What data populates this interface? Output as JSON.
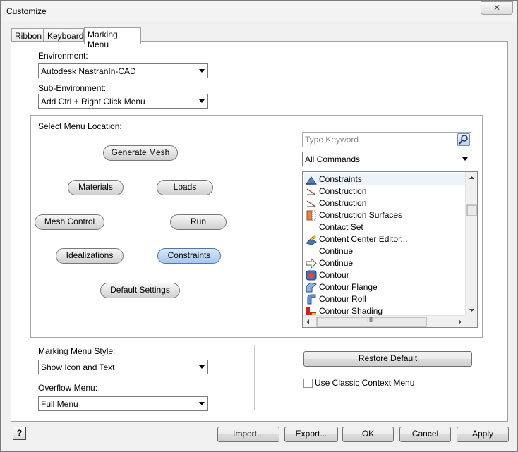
{
  "window": {
    "title": "Customize",
    "close_label": "✕"
  },
  "tabs": [
    {
      "label": "Ribbon"
    },
    {
      "label": "Keyboard"
    },
    {
      "label": "Marking Menu"
    }
  ],
  "environment": {
    "label": "Environment:",
    "value": "Autodesk NastranIn-CAD"
  },
  "sub_environment": {
    "label": "Sub-Environment:",
    "value": "Add Ctrl + Right Click Menu"
  },
  "menu_location": {
    "label": "Select Menu Location:",
    "pills": [
      {
        "label": "Generate Mesh"
      },
      {
        "label": "Materials"
      },
      {
        "label": "Loads"
      },
      {
        "label": "Mesh Control"
      },
      {
        "label": "Run"
      },
      {
        "label": "Idealizations"
      },
      {
        "label": "Constraints",
        "selected": true
      },
      {
        "label": "Default Settings"
      }
    ]
  },
  "search": {
    "placeholder": "Type Keyword",
    "icon": "search-icon"
  },
  "filter": {
    "value": "All Commands"
  },
  "commands": [
    {
      "label": "Constraints",
      "icon": "constraints-icon"
    },
    {
      "label": "Construction",
      "icon": "construction-line-icon"
    },
    {
      "label": "Construction",
      "icon": "construction-line-icon"
    },
    {
      "label": "Construction Surfaces",
      "icon": "construction-surfaces-icon"
    },
    {
      "label": "Contact Set",
      "icon": ""
    },
    {
      "label": "Content Center Editor...",
      "icon": "content-center-icon"
    },
    {
      "label": "Continue",
      "icon": ""
    },
    {
      "label": "Continue",
      "icon": "arrow-right-icon"
    },
    {
      "label": "Contour",
      "icon": "contour-icon"
    },
    {
      "label": "Contour Flange",
      "icon": "contour-flange-icon"
    },
    {
      "label": "Contour Roll",
      "icon": "contour-roll-icon"
    },
    {
      "label": "Contour Shading",
      "icon": "contour-shading-icon"
    }
  ],
  "scroll": {
    "grip": "III"
  },
  "restore_default": {
    "label": "Restore Default"
  },
  "marking_menu_style": {
    "label": "Marking Menu Style:",
    "value": "Show Icon and Text"
  },
  "overflow_menu": {
    "label": "Overflow Menu:",
    "value": "Full Menu"
  },
  "classic_context": {
    "label": "Use Classic Context Menu",
    "checked": false
  },
  "footer": {
    "help_icon": "help-icon",
    "help_label": "?",
    "import_label": "Import...",
    "export_label": "Export...",
    "ok_label": "OK",
    "cancel_label": "Cancel",
    "apply_label": "Apply"
  }
}
